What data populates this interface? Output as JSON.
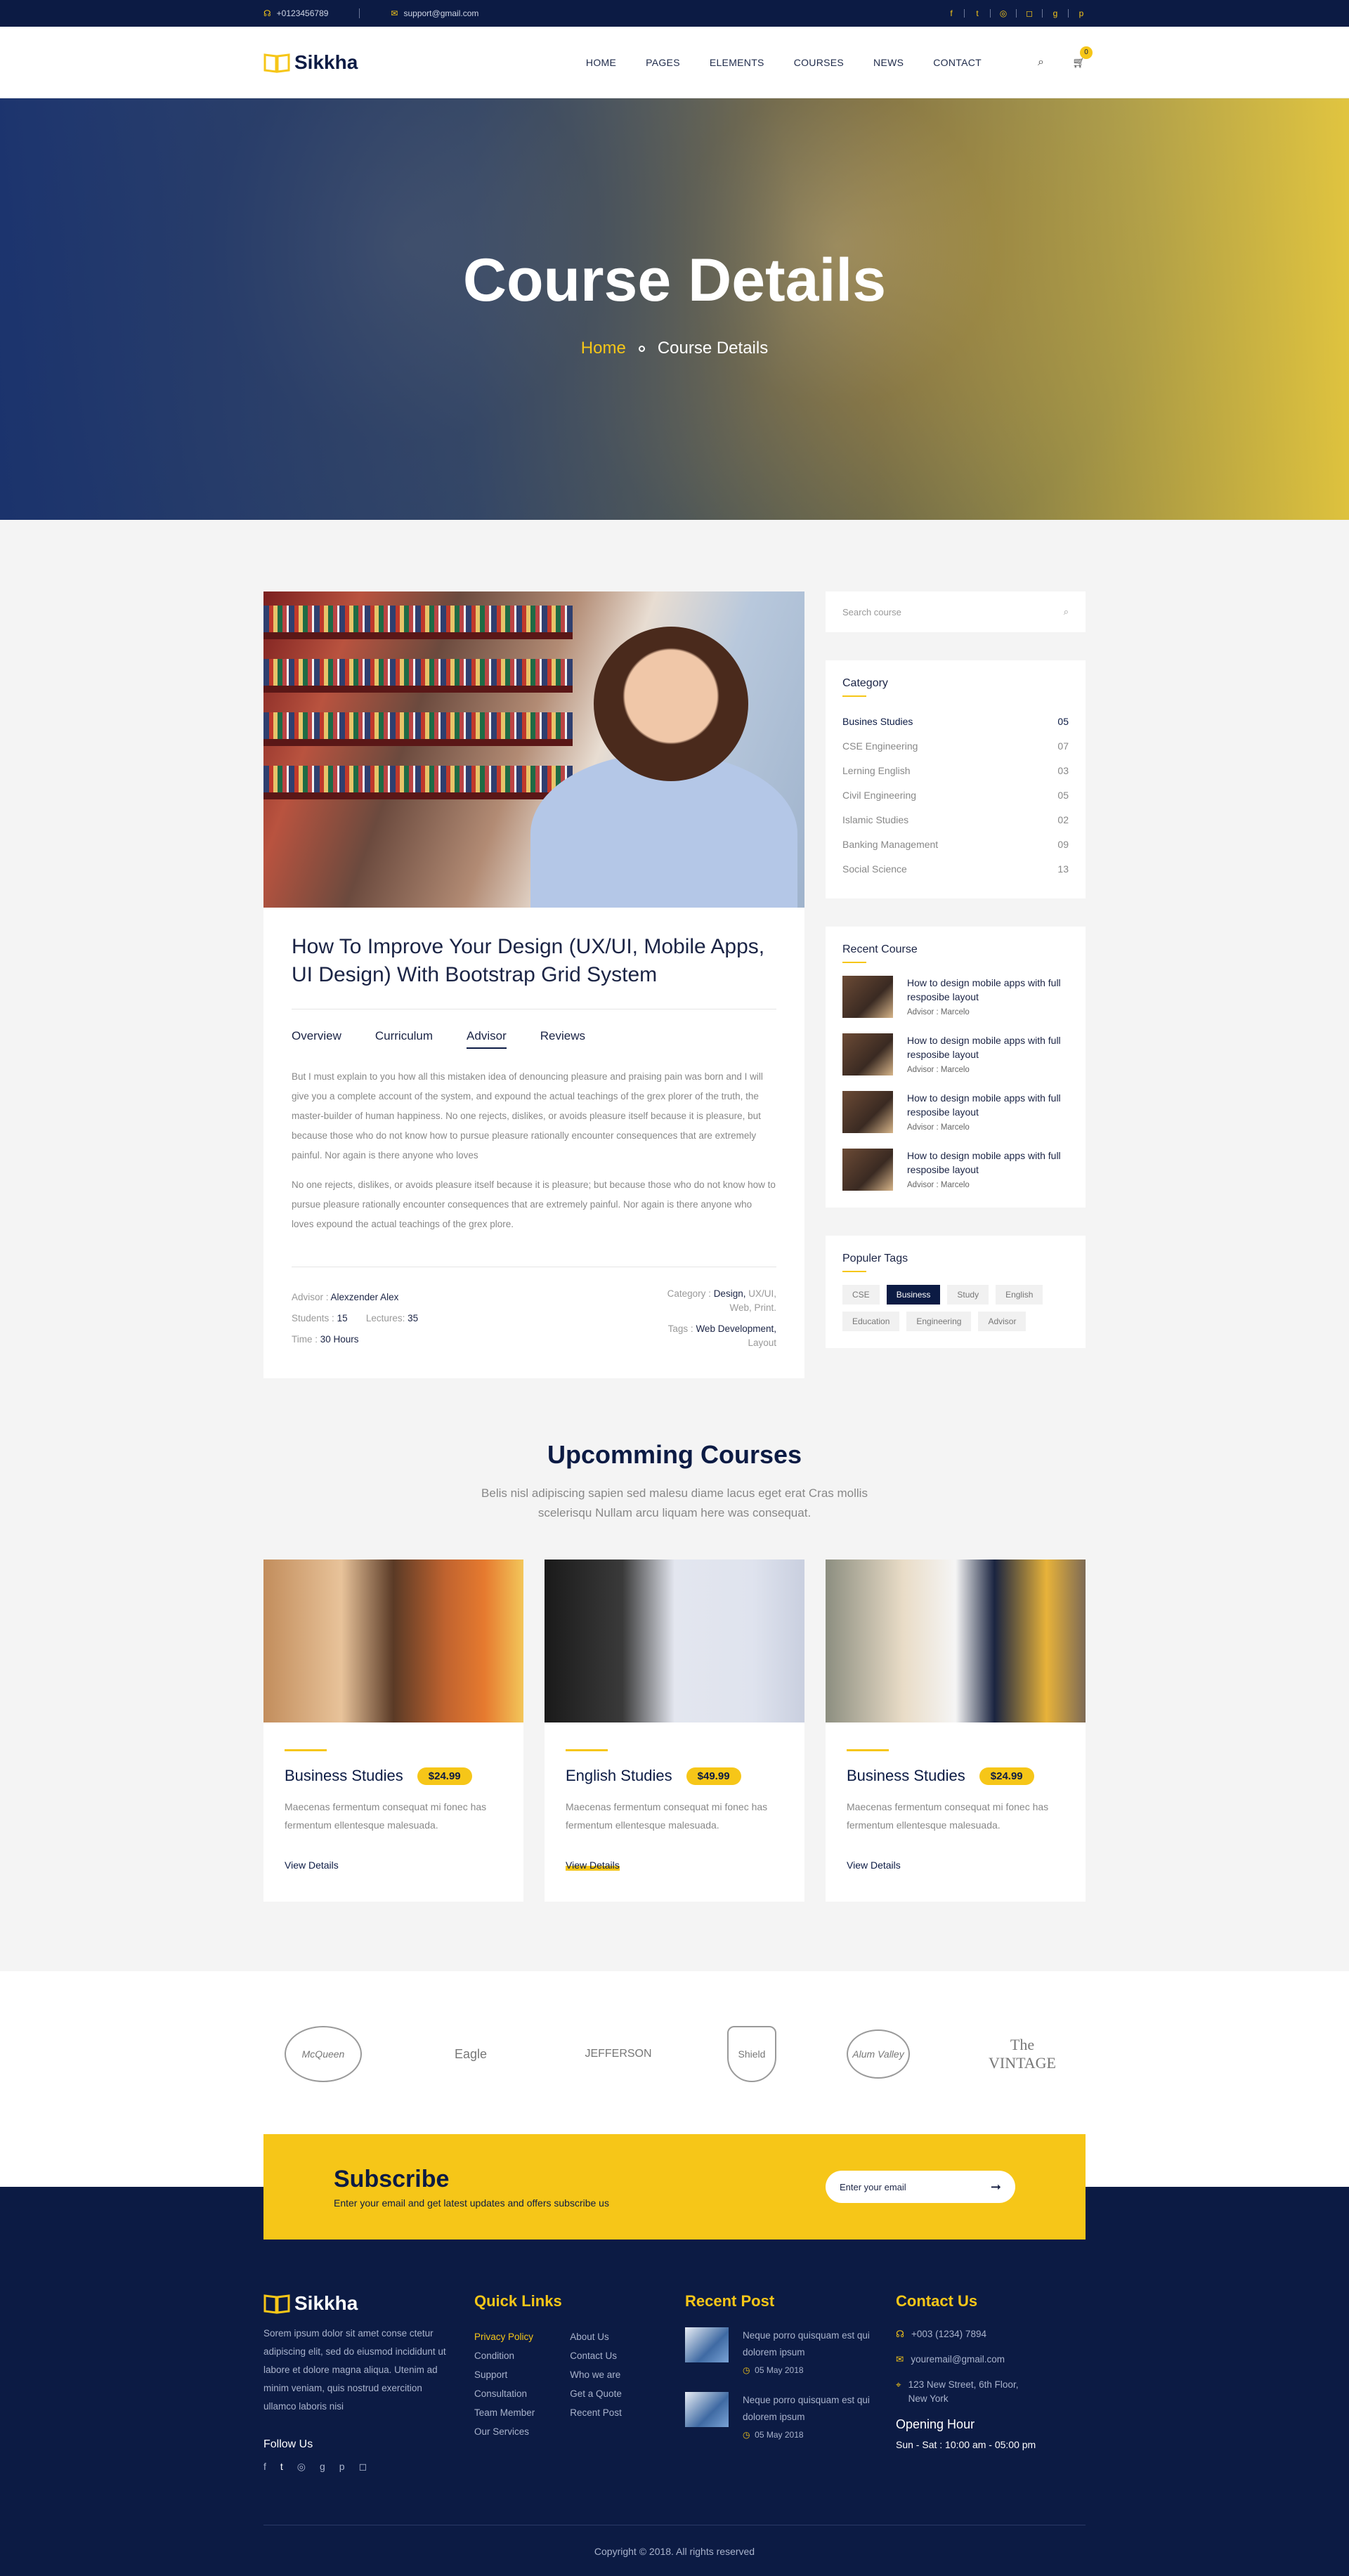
{
  "topbar": {
    "phone": "+0123456789",
    "email": "support@gmail.com",
    "socials": [
      "facebook-icon",
      "twitter-icon",
      "dribbble-icon",
      "instagram-icon",
      "google-plus-icon",
      "pinterest-icon"
    ]
  },
  "header": {
    "logo": "Sikkha",
    "nav": [
      "HOME",
      "PAGES",
      "ELEMENTS",
      "COURSES",
      "NEWS",
      "CONTACT"
    ],
    "cart_count": "0"
  },
  "hero": {
    "title": "Course Details",
    "crumb_home": "Home",
    "crumb_current": "Course Details"
  },
  "article": {
    "title": "How To Improve Your Design (UX/UI, Mobile Apps, UI Design) With Bootstrap Grid System",
    "tabs": [
      "Overview",
      "Curriculum",
      "Advisor",
      "Reviews"
    ],
    "active_tab": "Advisor",
    "para1": "But I must explain to you how all this mistaken idea of denouncing pleasure and praising pain was born and I will give you a complete account of the system, and expound the actual teachings of the grex plorer of the truth, the master-builder of human happiness. No one rejects, dislikes, or avoids pleasure itself because it is pleasure, but because those who do not know how to pursue pleasure rationally encounter consequences that are extremely painful. Nor again is there anyone who loves",
    "para2": "No one rejects, dislikes, or avoids pleasure itself because it is pleasure; but because those who do not know how to pursue pleasure rationally encounter consequences that are extremely painful. Nor again is there anyone who loves expound the actual teachings of the grex plore.",
    "meta": {
      "advisor_label": "Advisor :",
      "advisor": "Alexzender Alex",
      "students_label": "Students :",
      "students": "15",
      "lectures_label": "Lectures:",
      "lectures": "35",
      "time_label": "Time :",
      "time": "30 Hours",
      "category_label": "Category :",
      "category_main": "Design,",
      "category_rest": "UX/UI, Web, Print.",
      "tags_label": "Tags :",
      "tags_main": "Web Development,",
      "tags_rest": "Layout"
    }
  },
  "sidebar": {
    "search_placeholder": "Search course",
    "category_title": "Category",
    "categories": [
      {
        "name": "Busines Studies",
        "count": "05"
      },
      {
        "name": "CSE Engineering",
        "count": "07"
      },
      {
        "name": "Lerning English",
        "count": "03"
      },
      {
        "name": "Civil Engineering",
        "count": "05"
      },
      {
        "name": "Islamic Studies",
        "count": "02"
      },
      {
        "name": "Banking Management",
        "count": "09"
      },
      {
        "name": "Social Science",
        "count": "13"
      }
    ],
    "recent_title": "Recent Course",
    "recent": [
      {
        "title": "How to design mobile apps with full resposibe layout",
        "advisor": "Advisor : Marcelo"
      },
      {
        "title": "How to design mobile apps with full resposibe layout",
        "advisor": "Advisor : Marcelo"
      },
      {
        "title": "How to design mobile apps with full resposibe layout",
        "advisor": "Advisor : Marcelo"
      },
      {
        "title": "How to design mobile apps with full resposibe layout",
        "advisor": "Advisor : Marcelo"
      }
    ],
    "tags_title": "Populer Tags",
    "tags": [
      "CSE",
      "Business",
      "Study",
      "English",
      "Education",
      "Engineering",
      "Advisor"
    ],
    "active_tag": "Business"
  },
  "upcoming": {
    "title": "Upcomming Courses",
    "subtitle": "Belis nisl adipiscing sapien sed malesu diame lacus eget erat Cras mollis scelerisqu Nullam arcu liquam here was consequat.",
    "cards": [
      {
        "title": "Business Studies",
        "price": "$24.99",
        "desc": "Maecenas fermentum consequat mi fonec has fermentum ellentesque malesuada.",
        "link": "View Details"
      },
      {
        "title": "English Studies",
        "price": "$49.99",
        "desc": "Maecenas fermentum consequat mi fonec has fermentum ellentesque malesuada.",
        "link": "View Details"
      },
      {
        "title": "Business Studies",
        "price": "$24.99",
        "desc": "Maecenas fermentum consequat mi fonec has fermentum ellentesque malesuada.",
        "link": "View Details"
      }
    ]
  },
  "brands": [
    "McQueen",
    "Eagle",
    "JEFFERSON",
    "Shield",
    "Alum Valley",
    "The VINTAGE"
  ],
  "subscribe": {
    "title": "Subscribe",
    "text": "Enter your email and get latest updates and offers subscribe us",
    "placeholder": "Enter your email"
  },
  "footer": {
    "logo": "Sikkha",
    "about": "Sorem ipsum dolor sit amet conse ctetur adipiscing elit, sed do eiusmod incididunt ut labore et dolore magna aliqua. Utenim ad minim veniam, quis nostrud exercition ullamco laboris nisi",
    "follow": "Follow Us",
    "quick_title": "Quick Links",
    "links_a": [
      "Privacy Policy",
      "Condition",
      "Support",
      "Consultation",
      "Team Member",
      "Our Services"
    ],
    "links_b": [
      "About Us",
      "Contact Us",
      "Who we are",
      "Get a Quote",
      "Recent Post"
    ],
    "recent_title": "Recent Post",
    "posts": [
      {
        "text": "Neque porro quisquam est qui dolorem ipsum",
        "date": "05 May 2018"
      },
      {
        "text": "Neque porro quisquam est qui dolorem ipsum",
        "date": "05 May 2018"
      }
    ],
    "contact_title": "Contact Us",
    "phone": "+003 (1234) 7894",
    "email": "youremail@gmail.com",
    "address": "123 New Street, 6th Floor, New York",
    "hours_title": "Opening Hour",
    "hours": "Sun - Sat : 10:00 am - 05:00 pm",
    "copyright": "Copyright © 2018. All rights reserved"
  },
  "colors": {
    "navy": "#0c1b44",
    "yellow": "#f6c618"
  }
}
